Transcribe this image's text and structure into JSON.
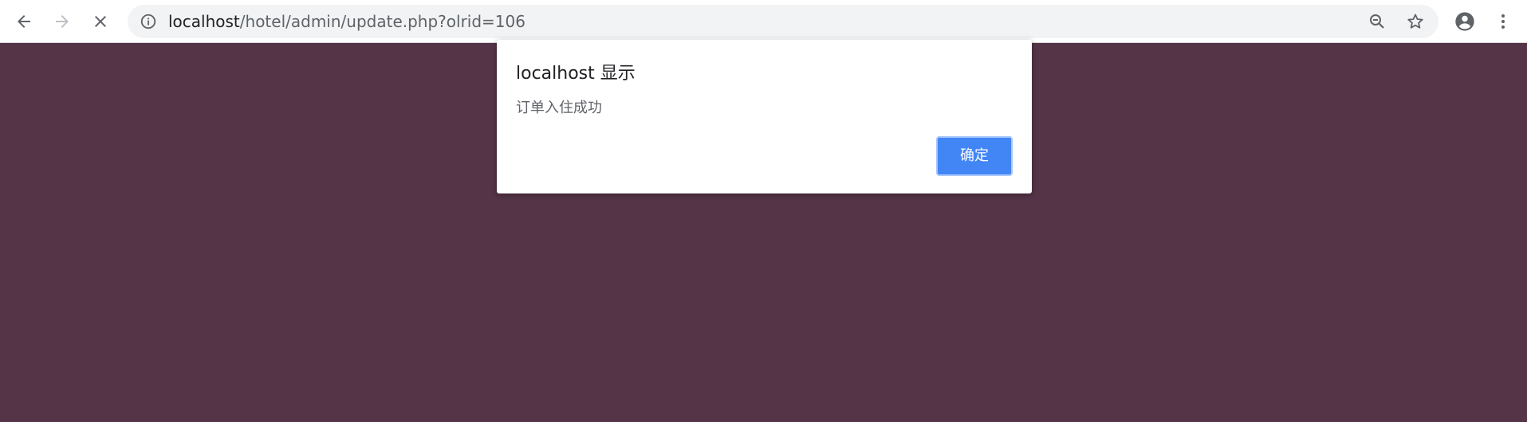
{
  "browser": {
    "url_host": "localhost",
    "url_path": "/hotel/admin/update.php?olrid=106",
    "icons": {
      "back": "back-arrow-icon",
      "forward": "forward-arrow-icon",
      "stop": "stop-loading-icon",
      "site_info": "info-icon",
      "zoom": "zoom-out-icon",
      "bookmark": "star-icon",
      "profile": "account-circle-icon",
      "menu": "more-vert-icon"
    }
  },
  "page": {
    "background_color": "#553448"
  },
  "dialog": {
    "title": "localhost 显示",
    "message": "订单入住成功",
    "ok_label": "确定",
    "button_color": "#4285f4"
  }
}
